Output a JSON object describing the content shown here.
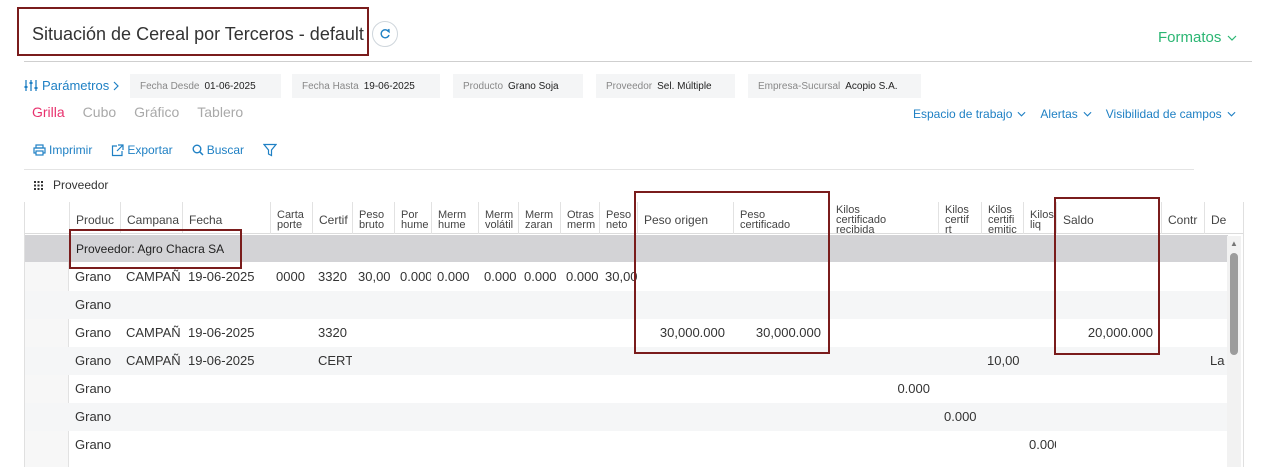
{
  "header": {
    "title": "Situación de Cereal por Terceros - default",
    "formatos_label": "Formatos"
  },
  "params": {
    "label": "Parámetros",
    "filters": [
      {
        "label": "Fecha Desde",
        "value": "01-06-2025"
      },
      {
        "label": "Fecha Hasta",
        "value": "19-06-2025"
      },
      {
        "label": "Producto",
        "value": "Grano Soja"
      },
      {
        "label": "Proveedor",
        "value": "Sel. Múltiple"
      },
      {
        "label": "Empresa-Sucursal",
        "value": "Acopio S.A."
      }
    ]
  },
  "views": [
    "Grilla",
    "Cubo",
    "Gráfico",
    "Tablero"
  ],
  "right_menus": [
    "Espacio de trabajo",
    "Alertas",
    "Visibilidad de campos"
  ],
  "toolbar": {
    "print": "Imprimir",
    "export": "Exportar",
    "search": "Buscar"
  },
  "grouping": {
    "label": "Proveedor"
  },
  "columns": [
    [
      "Produc"
    ],
    [
      "Campana"
    ],
    [
      "Fecha"
    ],
    [
      "Carta",
      "porte"
    ],
    [
      "Certif"
    ],
    [
      "Peso",
      "bruto"
    ],
    [
      "Por",
      "hume"
    ],
    [
      "Merm",
      "hume"
    ],
    [
      "Merm",
      "volátil"
    ],
    [
      "Merm",
      "zaran"
    ],
    [
      "Otras",
      "merm"
    ],
    [
      "Peso",
      "neto"
    ],
    [
      "Peso origen"
    ],
    [
      "Peso",
      "certificado"
    ],
    [
      "Kilos",
      "certificado",
      "recibida"
    ],
    [
      "Kilos",
      "certif",
      "rt"
    ],
    [
      "Kilos",
      "certifi",
      "emitic"
    ],
    [
      "Kilos",
      "liq"
    ],
    [
      "Saldo"
    ],
    [
      "Contr"
    ],
    [
      "De"
    ]
  ],
  "group_row": "Proveedor: Agro Chacra SA",
  "rows": [
    {
      "producto": "Grano",
      "campana": "CAMPAÑ",
      "fecha": "19-06-2025",
      "carta": "0000",
      "certif": "3320",
      "bruto": "30,00",
      "por_hume": "0.000",
      "merm_hume": "0.000",
      "merm_vol": "0.000",
      "merm_zar": "0.000",
      "otras": "0.000",
      "neto": "30,00",
      "peso_origen": "",
      "peso_cert": "",
      "kc_rec": "",
      "kc_rt": "",
      "kc_emit": "",
      "k_liq": "",
      "saldo": "",
      "contr": "",
      "de": ""
    },
    {
      "producto": "Grano",
      "campana": "",
      "fecha": "",
      "carta": "",
      "certif": "",
      "bruto": "",
      "por_hume": "",
      "merm_hume": "",
      "merm_vol": "",
      "merm_zar": "",
      "otras": "",
      "neto": "",
      "peso_origen": "",
      "peso_cert": "",
      "kc_rec": "",
      "kc_rt": "",
      "kc_emit": "",
      "k_liq": "",
      "saldo": "",
      "contr": "",
      "de": ""
    },
    {
      "producto": "Grano",
      "campana": "CAMPAÑ",
      "fecha": "19-06-2025",
      "carta": "",
      "certif": "3320",
      "bruto": "",
      "por_hume": "",
      "merm_hume": "",
      "merm_vol": "",
      "merm_zar": "",
      "otras": "",
      "neto": "",
      "peso_origen": "30,000.000",
      "peso_cert": "30,000.000",
      "kc_rec": "",
      "kc_rt": "",
      "kc_emit": "",
      "k_liq": "",
      "saldo": "20,000.000",
      "contr": "",
      "de": ""
    },
    {
      "producto": "Grano",
      "campana": "CAMPAÑ",
      "fecha": "19-06-2025",
      "carta": "",
      "certif": "CERT",
      "bruto": "",
      "por_hume": "",
      "merm_hume": "",
      "merm_vol": "",
      "merm_zar": "",
      "otras": "",
      "neto": "",
      "peso_origen": "",
      "peso_cert": "",
      "kc_rec": "",
      "kc_rt": "",
      "kc_emit": "10,00",
      "k_liq": "",
      "saldo": "",
      "contr": "",
      "de": "La"
    },
    {
      "producto": "Grano",
      "campana": "",
      "fecha": "",
      "carta": "",
      "certif": "",
      "bruto": "",
      "por_hume": "",
      "merm_hume": "",
      "merm_vol": "",
      "merm_zar": "",
      "otras": "",
      "neto": "",
      "peso_origen": "",
      "peso_cert": "",
      "kc_rec": "0.000",
      "kc_rt": "",
      "kc_emit": "",
      "k_liq": "",
      "saldo": "",
      "contr": "",
      "de": ""
    },
    {
      "producto": "Grano",
      "campana": "",
      "fecha": "",
      "carta": "",
      "certif": "",
      "bruto": "",
      "por_hume": "",
      "merm_hume": "",
      "merm_vol": "",
      "merm_zar": "",
      "otras": "",
      "neto": "",
      "peso_origen": "",
      "peso_cert": "",
      "kc_rec": "",
      "kc_rt": "0.000",
      "kc_emit": "",
      "k_liq": "",
      "saldo": "",
      "contr": "",
      "de": ""
    },
    {
      "producto": "Grano",
      "campana": "",
      "fecha": "",
      "carta": "",
      "certif": "",
      "bruto": "",
      "por_hume": "",
      "merm_hume": "",
      "merm_vol": "",
      "merm_zar": "",
      "otras": "",
      "neto": "",
      "peso_origen": "",
      "peso_cert": "",
      "kc_rec": "",
      "kc_rt": "",
      "kc_emit": "",
      "k_liq": "0.000",
      "saldo": "",
      "contr": "",
      "de": ""
    }
  ],
  "colors": {
    "accent_green": "#2bb673",
    "link_blue": "#1f80c4",
    "active_tab": "#e8326e",
    "highlight": "#7a1c1c"
  }
}
